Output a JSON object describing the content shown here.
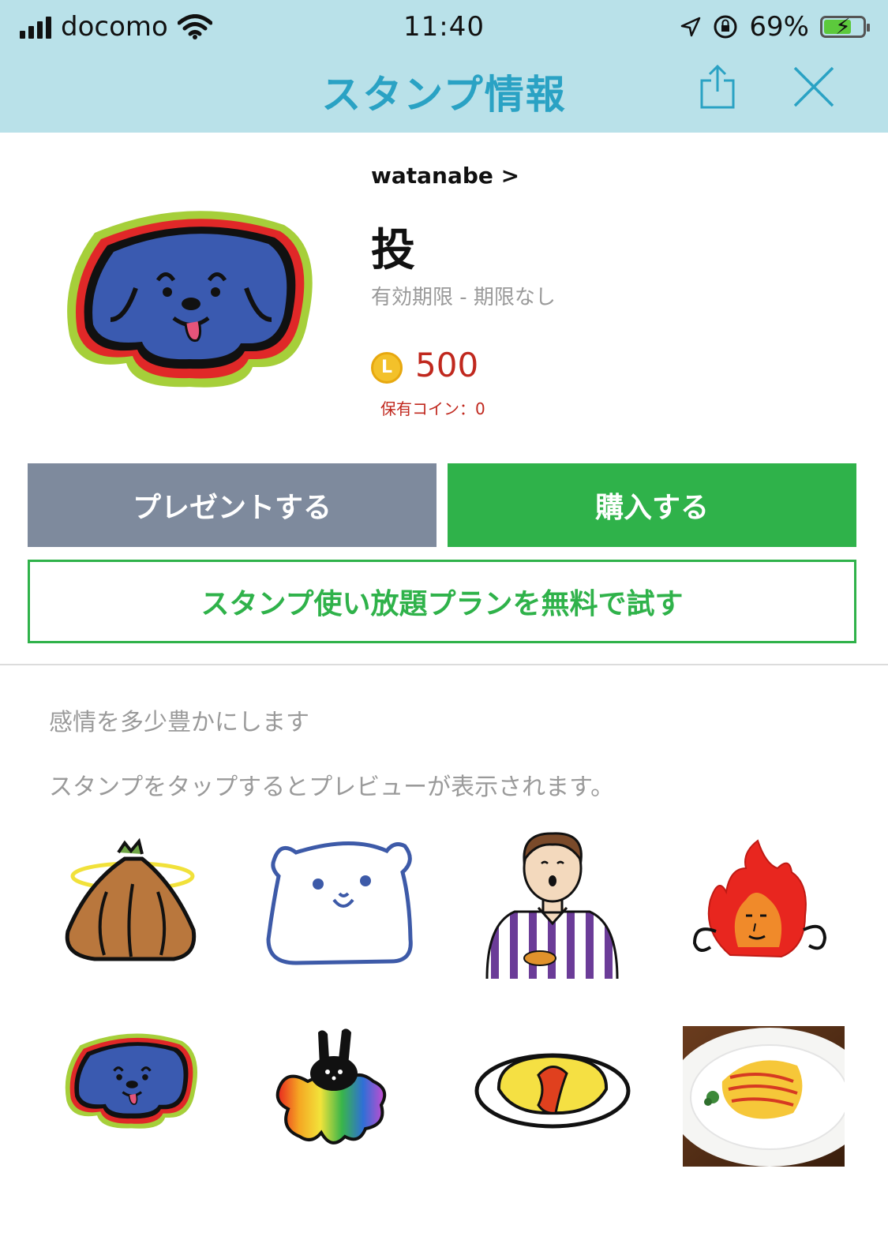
{
  "status_bar": {
    "carrier": "docomo",
    "time": "11:40",
    "battery": "69%"
  },
  "nav": {
    "title": "スタンプ情報",
    "share_icon": "share-icon",
    "close_icon": "close-icon"
  },
  "sticker_set": {
    "author": "watanabe >",
    "title": "投",
    "expiry": "有効期限 - 期限なし",
    "coin_symbol": "L",
    "price": "500",
    "coins_owned": "保有コイン：0"
  },
  "buttons": {
    "present": "プレゼントする",
    "buy": "購入する",
    "trial": "スタンプ使い放題プランを無料で試す"
  },
  "description": "感情を多少豊かにします",
  "preview_hint": "スタンプをタップするとプレビューが表示されます。",
  "stickers": [
    {
      "icon": "onion-angel-sticker"
    },
    {
      "icon": "white-bear-sticker"
    },
    {
      "icon": "man-striped-shirt-sticker"
    },
    {
      "icon": "fire-character-sticker"
    },
    {
      "icon": "blue-dog-sticker"
    },
    {
      "icon": "rainbow-rabbit-sticker"
    },
    {
      "icon": "omelet-drawing-sticker"
    },
    {
      "icon": "omelet-photo-sticker"
    }
  ],
  "colors": {
    "header_bg": "#b9e1e9",
    "title_blue": "#2aa2c4",
    "buy_green": "#2fb24a",
    "present_gray": "#7e8a9d",
    "price_red": "#c0281e"
  }
}
